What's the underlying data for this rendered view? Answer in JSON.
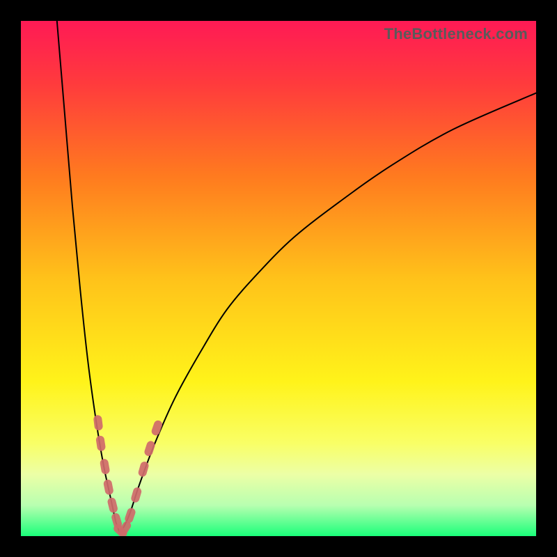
{
  "watermark": "TheBottleneck.com",
  "colors": {
    "frame": "#000000",
    "curve": "#000000",
    "marker_fill": "#cf6a6a",
    "gradient_stops": [
      {
        "offset": 0.0,
        "color": "#ff1a55"
      },
      {
        "offset": 0.12,
        "color": "#ff3a3d"
      },
      {
        "offset": 0.3,
        "color": "#ff7a1f"
      },
      {
        "offset": 0.5,
        "color": "#ffc21a"
      },
      {
        "offset": 0.7,
        "color": "#fff31a"
      },
      {
        "offset": 0.82,
        "color": "#f9ff66"
      },
      {
        "offset": 0.88,
        "color": "#ecffa6"
      },
      {
        "offset": 0.94,
        "color": "#b8ffb0"
      },
      {
        "offset": 1.0,
        "color": "#1aff7a"
      }
    ]
  },
  "chart_data": {
    "type": "line",
    "title": "",
    "xlabel": "",
    "ylabel": "",
    "x_range": [
      0,
      100
    ],
    "y_range": [
      0,
      100
    ],
    "note": "V-shaped curve with minimum near x≈18–20. Left branch rises steeply toward y=100 as x→~7; right branch rises with decreasing slope toward y≈86 at x=100. Values are estimated from pixel positions; no axes or tick labels are shown in the image.",
    "series": [
      {
        "name": "left-branch",
        "x": [
          7.0,
          8.5,
          10.0,
          11.5,
          13.0,
          14.5,
          16.0,
          17.5,
          18.5,
          19.3
        ],
        "y": [
          100,
          82,
          64,
          48,
          34,
          23,
          14,
          7,
          2.5,
          0.5
        ]
      },
      {
        "name": "right-branch",
        "x": [
          19.3,
          21,
          23,
          26,
          30,
          35,
          40,
          46,
          53,
          62,
          72,
          84,
          100
        ],
        "y": [
          0.5,
          4,
          10,
          18,
          27,
          36,
          44,
          51,
          58,
          65,
          72,
          79,
          86
        ]
      }
    ],
    "markers": {
      "name": "highlighted-cluster",
      "shape": "rounded-capsule",
      "approx_points": [
        {
          "x": 15.0,
          "y": 22
        },
        {
          "x": 15.5,
          "y": 18
        },
        {
          "x": 16.3,
          "y": 13.5
        },
        {
          "x": 17.0,
          "y": 9.5
        },
        {
          "x": 17.8,
          "y": 6
        },
        {
          "x": 18.6,
          "y": 3
        },
        {
          "x": 19.3,
          "y": 1
        },
        {
          "x": 20.2,
          "y": 1.5
        },
        {
          "x": 21.2,
          "y": 4
        },
        {
          "x": 22.4,
          "y": 8
        },
        {
          "x": 23.8,
          "y": 13
        },
        {
          "x": 25.0,
          "y": 17
        },
        {
          "x": 26.4,
          "y": 21
        }
      ]
    }
  }
}
